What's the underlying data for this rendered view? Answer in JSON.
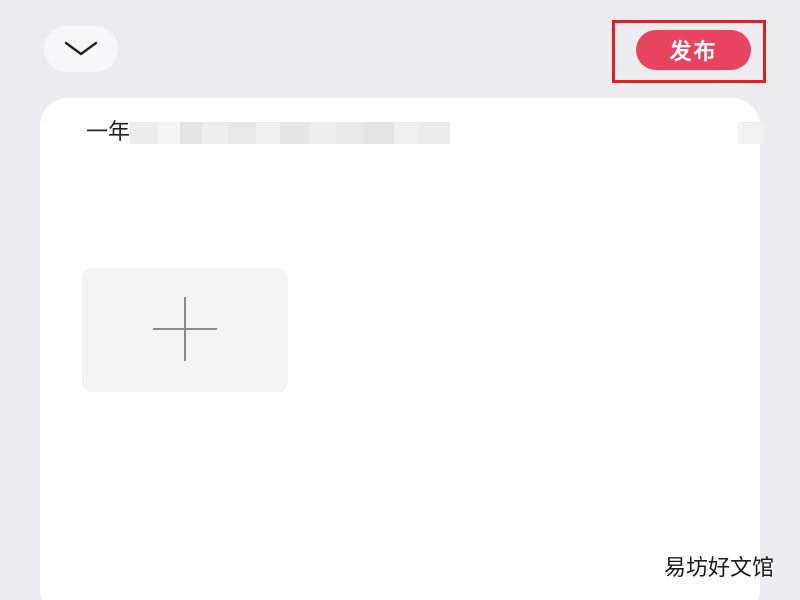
{
  "header": {
    "collapse_icon": "chevron-down-icon",
    "publish_label": "发布",
    "publish_color": "#e8435f",
    "highlight_color": "#e02020"
  },
  "editor": {
    "text_prefix": "一年",
    "add_image_icon": "plus-icon"
  },
  "watermark": {
    "text": "易坊好文馆"
  }
}
